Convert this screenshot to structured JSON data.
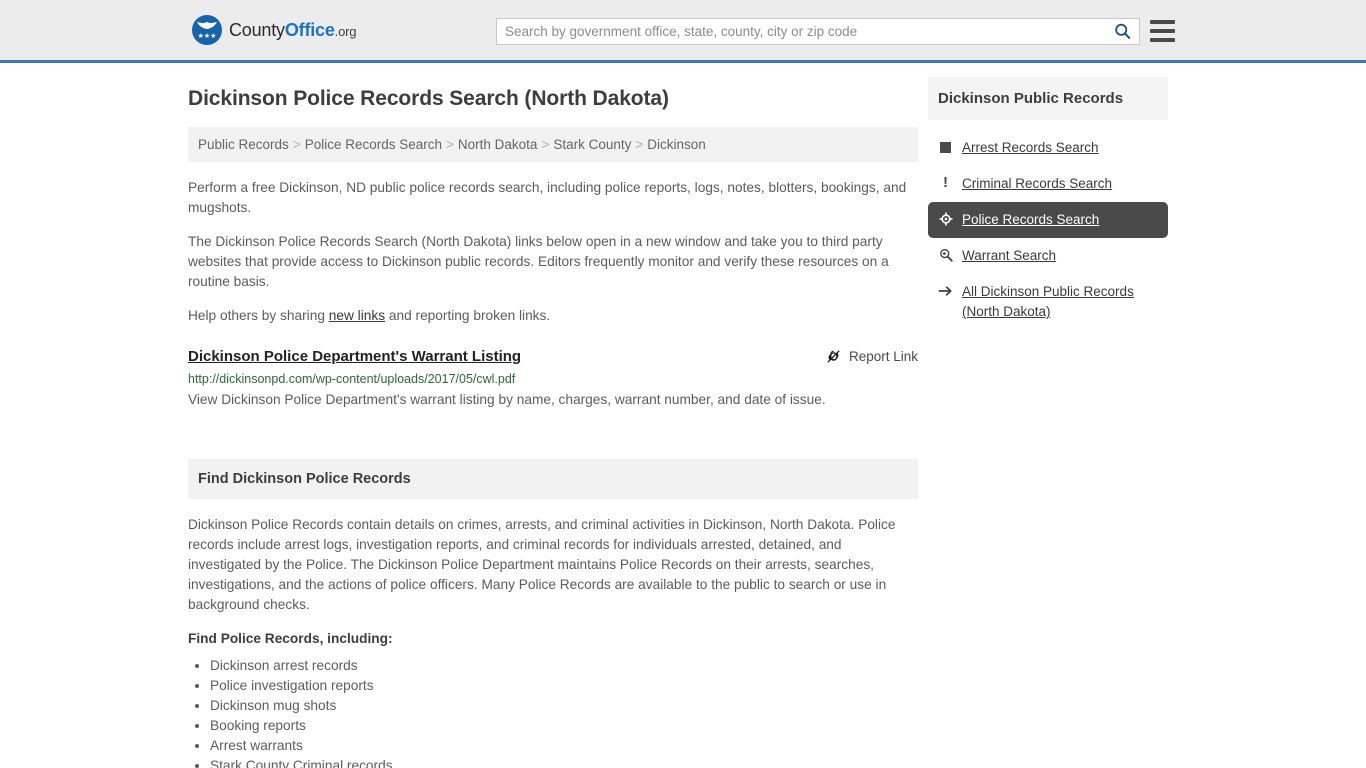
{
  "header": {
    "brand": {
      "part1": "County",
      "part2": "Office",
      "part3": ".org",
      "logo_icon": "eagle-seal-icon"
    },
    "search": {
      "placeholder": "Search by government office, state, county, city or zip code",
      "value": "",
      "search_icon": "search-icon"
    },
    "menu_icon": "hamburger-menu-icon",
    "accent_color": "#3d7ab0"
  },
  "page": {
    "title": "Dickinson Police Records Search (North Dakota)"
  },
  "breadcrumb": {
    "separator": ">",
    "items": [
      {
        "label": "Public Records"
      },
      {
        "label": "Police Records Search"
      },
      {
        "label": "North Dakota"
      },
      {
        "label": "Stark County"
      },
      {
        "label": "Dickinson"
      }
    ]
  },
  "intro": {
    "p1": "Perform a free Dickinson, ND public police records search, including police reports, logs, notes, blotters, bookings, and mugshots.",
    "p2": "The Dickinson Police Records Search (North Dakota) links below open in a new window and take you to third party websites that provide access to Dickinson public records. Editors frequently monitor and verify these resources on a routine basis.",
    "p3_before": "Help others by sharing ",
    "p3_link": "new links",
    "p3_after": " and reporting broken links."
  },
  "result": {
    "title": "Dickinson Police Department's Warrant Listing",
    "report_label": "Report Link",
    "report_icon": "broken-link-icon",
    "url": "http://dickinsonpd.com/wp-content/uploads/2017/05/cwl.pdf",
    "description": "View Dickinson Police Department's warrant listing by name, charges, warrant number, and date of issue.",
    "url_color": "#2a6b35"
  },
  "section": {
    "heading": "Find Dickinson Police Records",
    "paragraph": "Dickinson Police Records contain details on crimes, arrests, and criminal activities in Dickinson, North Dakota. Police records include arrest logs, investigation reports, and criminal records for individuals arrested, detained, and investigated by the Police. The Dickinson Police Department maintains Police Records on their arrests, searches, investigations, and the actions of police officers. Many Police Records are available to the public to search or use in background checks.",
    "sub_heading": "Find Police Records, including:",
    "list": [
      "Dickinson arrest records",
      "Police investigation reports",
      "Dickinson mug shots",
      "Booking reports",
      "Arrest warrants",
      "Stark County Criminal records"
    ]
  },
  "sidebar": {
    "heading": "Dickinson Public Records",
    "active_color": "#4a4a4a",
    "items": [
      {
        "label": "Arrest Records Search",
        "icon": "square-icon",
        "active": false
      },
      {
        "label": "Criminal Records Search",
        "icon": "exclamation-icon",
        "active": false
      },
      {
        "label": "Police Records Search",
        "icon": "police-badge-icon",
        "active": true
      },
      {
        "label": "Warrant Search",
        "icon": "magnifier-plus-icon",
        "active": false
      },
      {
        "label": "All Dickinson Public Records (North Dakota)",
        "icon": "arrow-right-icon",
        "active": false
      }
    ]
  }
}
